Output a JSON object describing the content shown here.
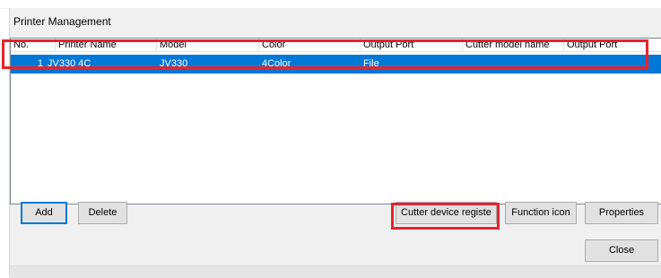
{
  "window": {
    "title": "Printer Management"
  },
  "list": {
    "columns": [
      "No.",
      "Printer Name",
      "Model",
      "Color",
      "Output Port",
      "Cutter model name",
      "Output Port"
    ],
    "rows": [
      {
        "no": "1",
        "printer_name": "JV330 4C",
        "model": "JV330",
        "color": "4Color",
        "output_port": "File",
        "cutter_model_name": "",
        "cutter_output_port": ""
      }
    ],
    "selected_row_color": "#0078d7"
  },
  "buttons": {
    "add": "Add",
    "delete": "Delete",
    "cutter_device_register": "Cutter device registe",
    "function_icon": "Function icon",
    "properties": "Properties",
    "close": "Close"
  },
  "annotation_color": "#e8232c"
}
